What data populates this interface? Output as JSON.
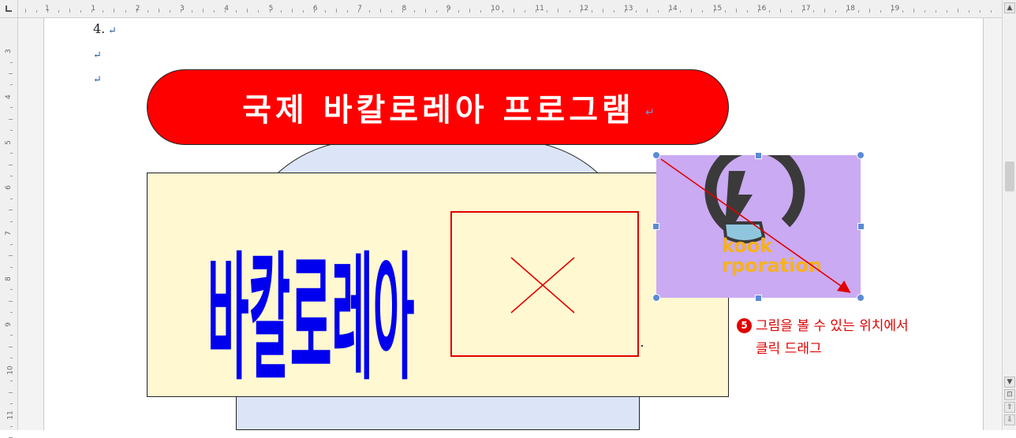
{
  "ruler": {
    "top_numbers": [
      "1",
      "1",
      "2",
      "3",
      "4",
      "5",
      "6",
      "7",
      "8",
      "9",
      "10",
      "11",
      "12",
      "13",
      "14",
      "15",
      "16",
      "17",
      "18",
      "19"
    ],
    "left_numbers": [
      "3",
      "4",
      "5",
      "6",
      "7",
      "8",
      "9",
      "10",
      "11"
    ]
  },
  "document": {
    "list_number": "4.",
    "para_mark": "↵",
    "title": "국제 바칼로레아 프로그램",
    "word_art_text": "바칼로레아",
    "broken_image_symbol": "×",
    "logo": {
      "line1": "kook",
      "line2": "rporation"
    }
  },
  "instruction": {
    "step": "5",
    "line1": "그림을 볼 수 있는 위치에서",
    "line2": "클릭 드래그"
  },
  "scrollbar": {
    "up": "▲",
    "down": "▼",
    "page_up": "⊡",
    "prev": "⇧",
    "next": "⇩"
  },
  "colors": {
    "title_red": "#ff0000",
    "word_art_blue": "#0000ee",
    "panel_yellow": "#fff8d0",
    "shape_blue": "#dbe5f7",
    "logo_purple": "#caaaf3",
    "annotation_red": "#e00000",
    "handle_blue": "#5b8bd6"
  }
}
